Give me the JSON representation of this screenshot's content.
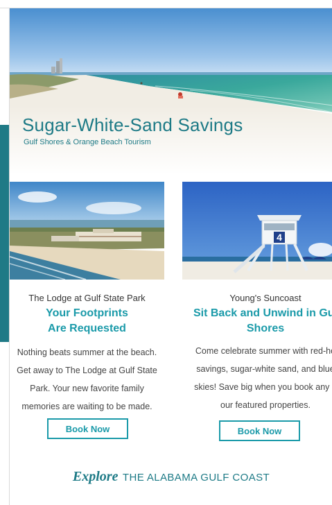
{
  "hero": {
    "title": "Sugar-White-Sand Savings",
    "subtitle": "Gulf Shores & Orange Beach Tourism"
  },
  "cards": [
    {
      "label": "The Lodge at Gulf State Park",
      "title_line1": "Your Footprints",
      "title_line2": "Are Requested",
      "desc_lines": [
        "Nothing beats summer at the beach.",
        "Get away to The Lodge at Gulf State",
        "Park. Your new favorite family",
        "memories are waiting to be made."
      ],
      "button": "Book Now"
    },
    {
      "label": "Young's Suncoast",
      "title_line1": "Sit Back and Unwind in Gul",
      "title_line2": "Shores",
      "desc_lines": [
        "Come celebrate summer with red-ho",
        "savings, sugar-white sand, and blue",
        "skies! Save big when you book any o",
        "our featured properties."
      ],
      "button": "Book Now",
      "tower_number": "4"
    }
  ],
  "footer": {
    "explore_word": "Explore",
    "rest": "THE ALABAMA GULF COAST"
  },
  "colors": {
    "brand_teal": "#1d7a86",
    "title_teal": "#1a9aa9",
    "side_bar": "#1f7a86"
  }
}
